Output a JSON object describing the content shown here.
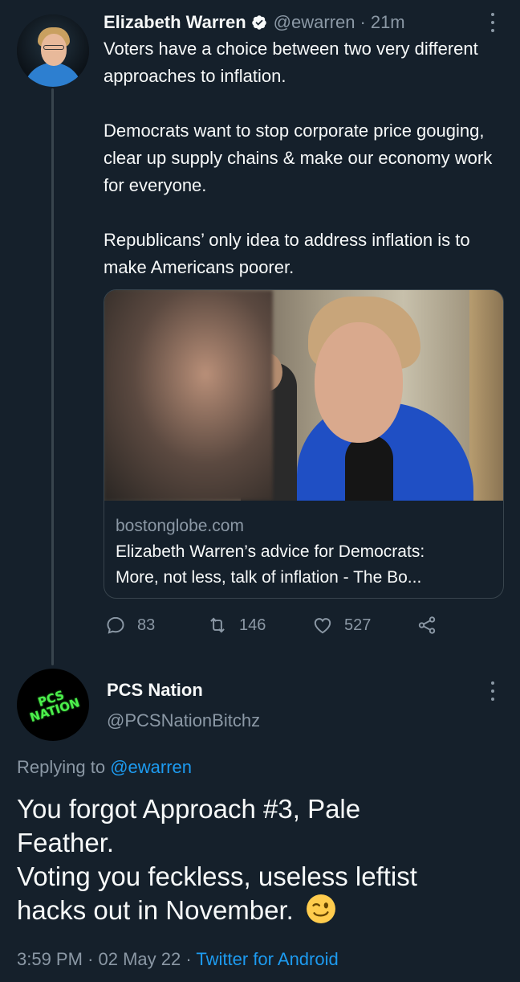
{
  "tweet": {
    "author_name": "Elizabeth Warren",
    "handle": "@ewarren",
    "separator": "·",
    "time_ago": "21m",
    "paragraphs": [
      "Voters have a choice between two very different approaches to inflation.",
      "Democrats want to stop corporate price gouging, clear up supply chains & make our economy work for everyone.",
      "Republicans’ only idea to address inflation is to make Americans poorer."
    ],
    "card": {
      "domain": "bostonglobe.com",
      "title_line1": "Elizabeth Warren’s advice for Democrats:",
      "title_line2": "More, not less, talk of inflation - The Bo..."
    },
    "stats": {
      "replies": "83",
      "retweets": "146",
      "likes": "527"
    }
  },
  "reply": {
    "author_name": "PCS Nation",
    "handle": "@PCSNationBitchz",
    "avatar_text_line1": "PCS",
    "avatar_text_line2": "NATION",
    "replying_prefix": "Replying to",
    "replying_to": "@ewarren",
    "text_line1": "You forgot Approach #3, Pale",
    "text_line2": "Feather.",
    "text_line3": "Voting you feckless, useless leftist",
    "text_line4": "hacks out in November.",
    "time": "3:59 PM",
    "date": "02 May 22",
    "separator": "·",
    "source": "Twitter for Android"
  },
  "colors": {
    "background": "#15202b",
    "text": "#f7f9f9",
    "muted": "#8b98a5",
    "accent": "#1d9bf0",
    "border": "#38444d"
  },
  "icons": [
    "verified-badge-icon",
    "more-options-icon",
    "reply-icon",
    "retweet-icon",
    "like-icon",
    "share-icon",
    "wink-emoji-icon"
  ]
}
